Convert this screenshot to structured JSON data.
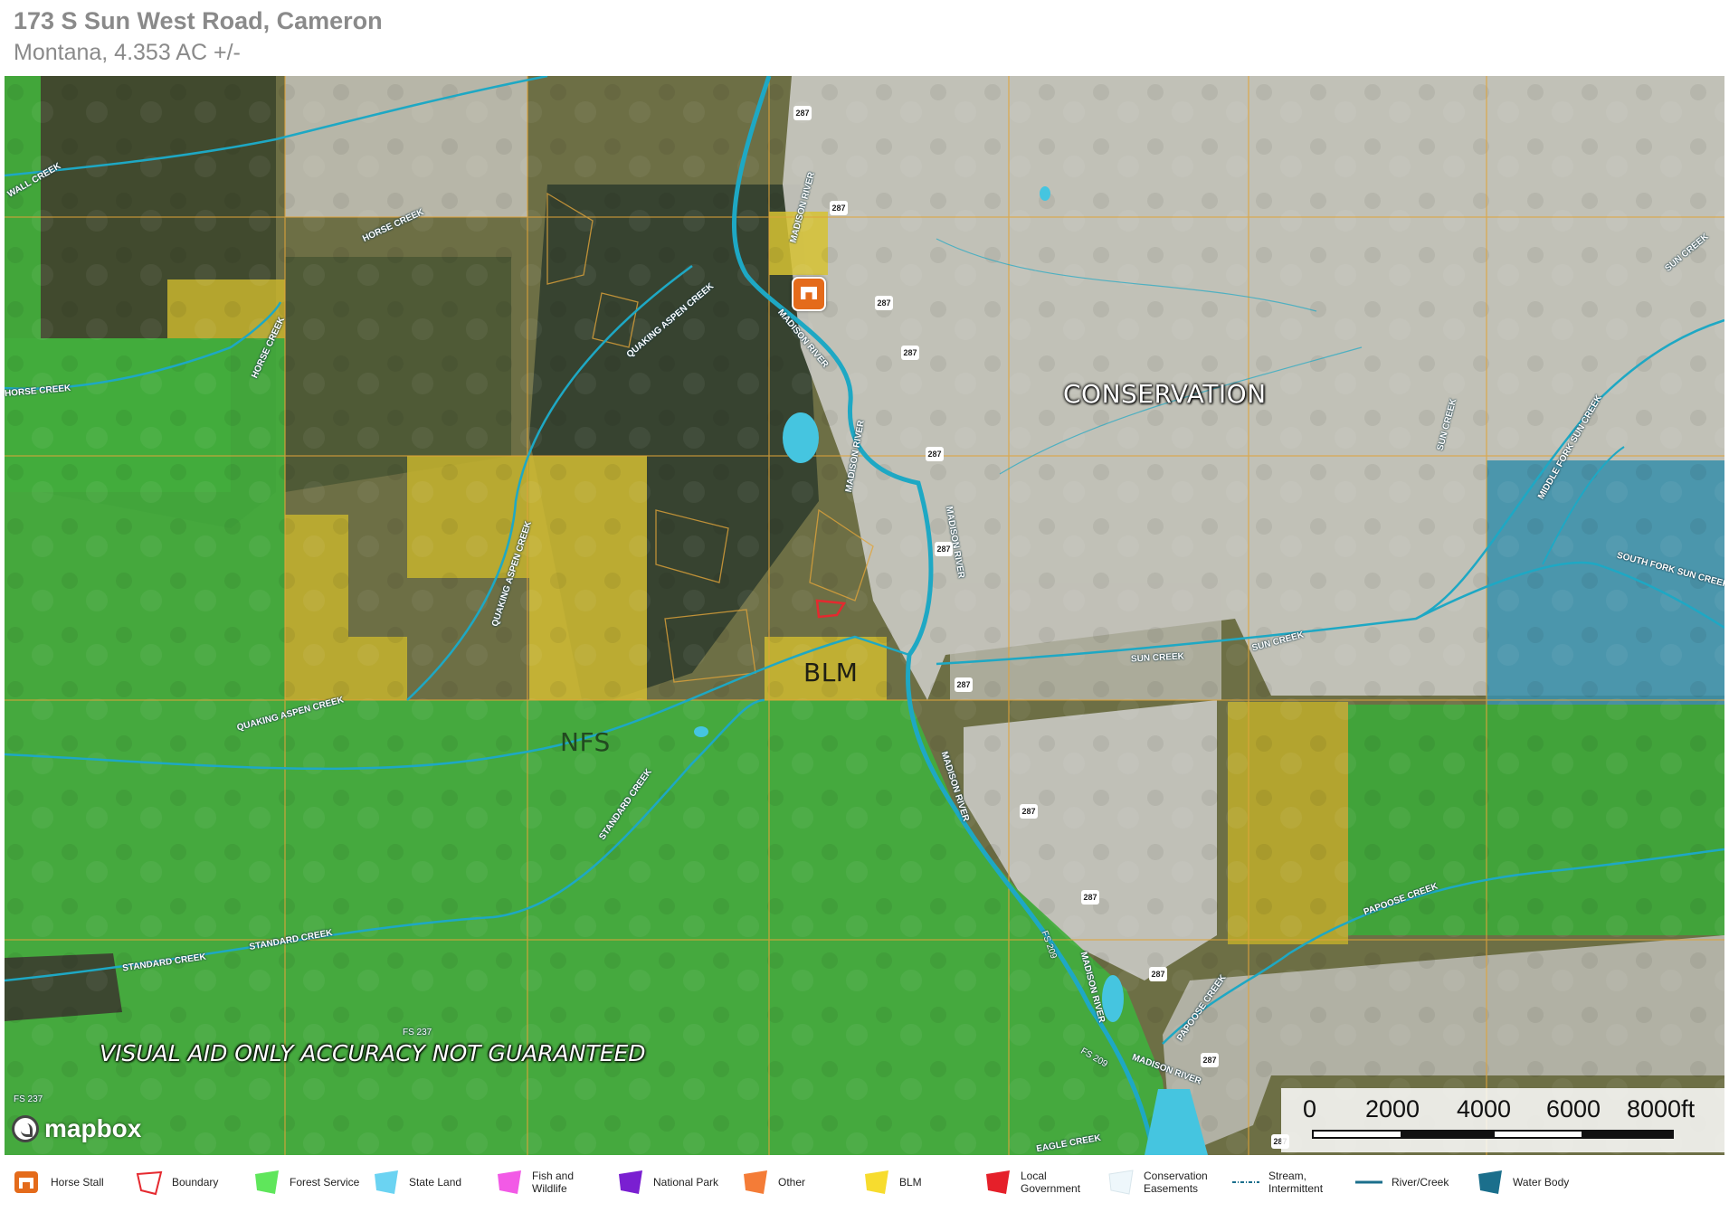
{
  "header": {
    "title": "173 S Sun West Road, Cameron",
    "subtitle": "Montana, 4.353 AC +/-"
  },
  "map": {
    "labels": {
      "conservation": "CONSERVATION",
      "blm": "BLM",
      "nfs": "NFS"
    },
    "disclaimer": "VISUAL AID ONLY ACCURACY NOT GUARANTEED",
    "attribution": "mapbox",
    "highway_shield": "287",
    "water_labels": [
      "HORSE CREEK",
      "HORSE CREEK",
      "HORSE CREEK",
      "WALL CREEK",
      "QUAKING ASPEN CREEK",
      "QUAKING ASPEN CREEK",
      "QUAKING ASPEN CREEK",
      "MADISON RIVER",
      "MADISON RIVER",
      "MADISON RIVER",
      "MADISON RIVER",
      "MADISON RIVER",
      "MADISON RIVER",
      "MADISON RIVER",
      "SUN CREEK",
      "SUN CREEK",
      "SUN CREEK",
      "SUN CREEK",
      "MIDDLE FORK SUN CREEK",
      "SOUTH FORK SUN CREEK",
      "STANDARD CREEK",
      "STANDARD CREEK",
      "STANDARD CREEK",
      "PAPOOSE CREEK",
      "PAPOOSE CREEK",
      "EAGLE CREEK"
    ],
    "road_labels": [
      "FS 237",
      "FS 237",
      "FS 209",
      "FS 209"
    ],
    "scale_bar": {
      "ticks": [
        "0",
        "2000",
        "4000",
        "6000",
        "8000ft"
      ]
    },
    "colors": {
      "forest_service": "#3fae3b",
      "blm": "#d8c431",
      "conservation": "#d6d6d2",
      "state_land": "#3a92b0",
      "river": "#1ea8c4",
      "boundary": "#e5292f",
      "parcel_line": "#e0a43a"
    }
  },
  "legend": [
    {
      "icon": "horse-stall-icon",
      "label": "Horse Stall",
      "color": "#e46b1b"
    },
    {
      "icon": "boundary-icon",
      "label": "Boundary",
      "color": "#e5292f"
    },
    {
      "icon": "forest-service-icon",
      "label": "Forest Service",
      "color": "#5fe65b"
    },
    {
      "icon": "state-land-icon",
      "label": "State Land",
      "color": "#6bd3f2"
    },
    {
      "icon": "fish-wildlife-icon",
      "label": "Fish and Wildlife",
      "color": "#f25ae6"
    },
    {
      "icon": "national-park-icon",
      "label": "National Park",
      "color": "#7a1fd1"
    },
    {
      "icon": "other-icon",
      "label": "Other",
      "color": "#f47c37"
    },
    {
      "icon": "blm-icon",
      "label": "BLM",
      "color": "#f7dc2e"
    },
    {
      "icon": "local-government-icon",
      "label": "Local Government",
      "color": "#e5202a"
    },
    {
      "icon": "conservation-easements-icon",
      "label": "Conservation Easements",
      "color": "#eef7fb"
    },
    {
      "icon": "stream-intermittent-icon",
      "label": "Stream, Intermittent",
      "color": "#1b6f8c"
    },
    {
      "icon": "river-creek-icon",
      "label": "River/Creek",
      "color": "#1b6f8c"
    },
    {
      "icon": "water-body-icon",
      "label": "Water Body",
      "color": "#1b6f8c"
    }
  ]
}
